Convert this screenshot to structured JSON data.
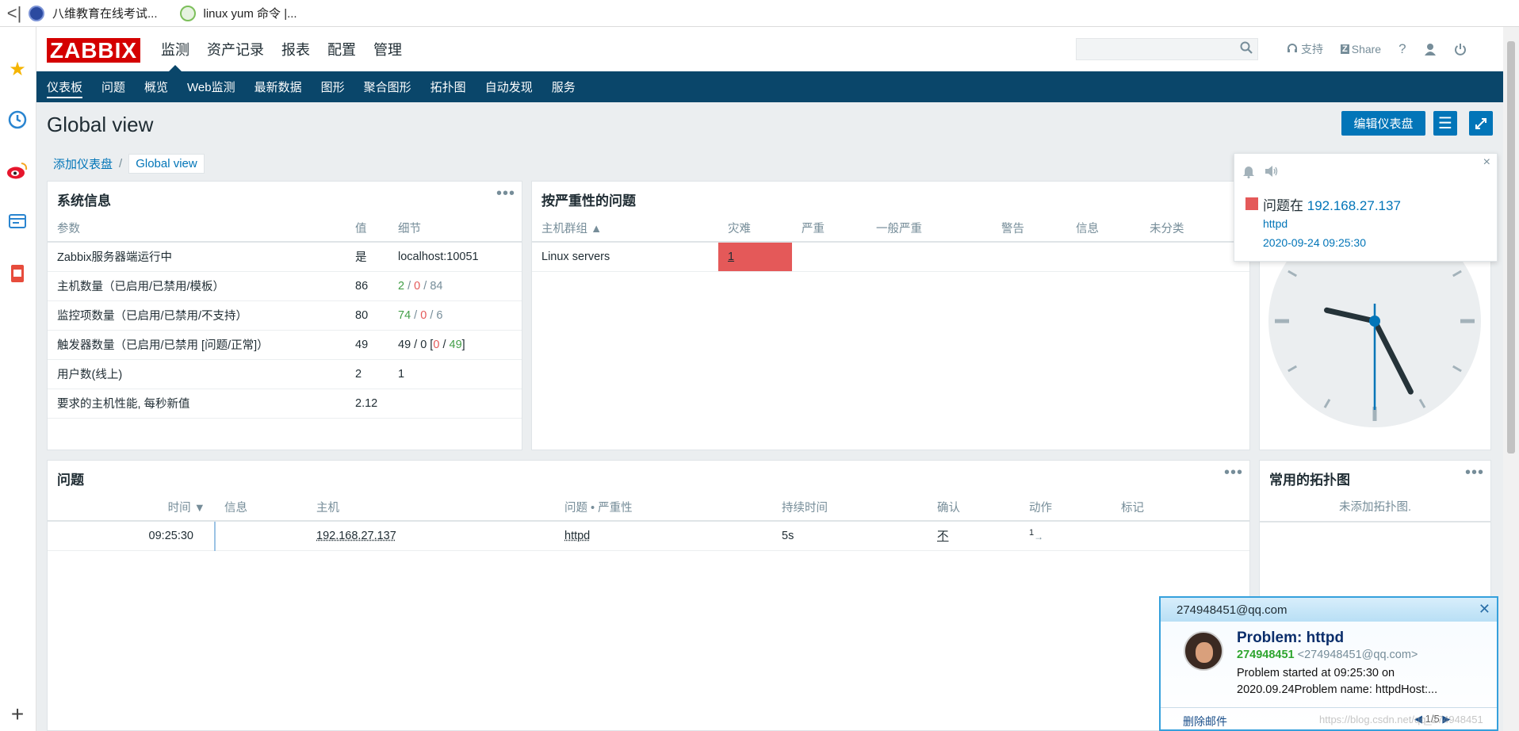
{
  "browser": {
    "bookmarks": [
      {
        "label": "八维教育在线考试..."
      },
      {
        "label": "linux yum 命令 |..."
      }
    ],
    "add_label": "+"
  },
  "header": {
    "logo": "ZABBIX",
    "menu": [
      "监测",
      "资产记录",
      "报表",
      "配置",
      "管理"
    ],
    "support_label": "支持",
    "share_label": "Share",
    "help_label": "?"
  },
  "submenu": [
    "仪表板",
    "问题",
    "概览",
    "Web监测",
    "最新数据",
    "图形",
    "聚合图形",
    "拓扑图",
    "自动发现",
    "服务"
  ],
  "page": {
    "title": "Global view",
    "edit_button": "编辑仪表盘",
    "breadcrumb": [
      "添加仪表盘",
      "Global view"
    ]
  },
  "sysinfo": {
    "title": "系统信息",
    "headers": [
      "参数",
      "值",
      "细节"
    ],
    "rows": [
      {
        "param": "Zabbix服务器端运行中",
        "value": "是",
        "detail": "localhost:10051"
      },
      {
        "param": "主机数量（已启用/已禁用/模板）",
        "value": "86",
        "d1": "2",
        "d2": "0",
        "d3": "84"
      },
      {
        "param": "监控项数量（已启用/已禁用/不支持）",
        "value": "80",
        "d1": "74",
        "d2": "0",
        "d3": "6"
      },
      {
        "param": "触发器数量（已启用/已禁用 [问题/正常]）",
        "value": "49",
        "d1": "49 / 0 [",
        "d2": "0",
        "d3": "49",
        "d4": "]"
      },
      {
        "param": "用户数(线上)",
        "value": "2",
        "d1": "1"
      },
      {
        "param": "要求的主机性能, 每秒新值",
        "value": "2.12"
      }
    ]
  },
  "severity": {
    "title": "按严重性的问题",
    "headers": [
      "主机群组 ▲",
      "灾难",
      "严重",
      "一般严重",
      "警告",
      "信息",
      "未分类"
    ],
    "row": {
      "group": "Linux servers",
      "disaster": "1"
    }
  },
  "problems": {
    "title": "问题",
    "headers": [
      "时间 ▼",
      "信息",
      "主机",
      "问题 • 严重性",
      "持续时间",
      "确认",
      "动作",
      "标记"
    ],
    "rows": [
      {
        "time": "09:25:30",
        "host": "192.168.27.137",
        "problem": "httpd",
        "duration": "5s",
        "ack": "不",
        "actions": "1"
      }
    ]
  },
  "maps": {
    "title": "常用的拓扑图",
    "empty": "未添加拓扑图."
  },
  "notification": {
    "prefix": "问题在",
    "host": "192.168.27.137",
    "problem": "httpd",
    "time": "2020-09-24 09:25:30"
  },
  "clock": {
    "hour": 9,
    "minute": 25,
    "second": 30
  },
  "qqmail": {
    "account": "274948451@qq.com",
    "subject": "Problem: httpd",
    "sender_name": "274948451",
    "sender_addr": "<274948451@qq.com>",
    "body_line1": "Problem started at 09:25:30 on",
    "body_line2": "2020.09.24Problem name: httpdHost:...",
    "delete_label": "删除邮件",
    "pager": "1/5",
    "watermark": "https://blog.csdn.net/qq_274948451"
  },
  "colors": {
    "brand": "#d40000",
    "nav": "#0a466a",
    "accent": "#0275b8",
    "disaster": "#e45959",
    "ok": "#429e47"
  }
}
